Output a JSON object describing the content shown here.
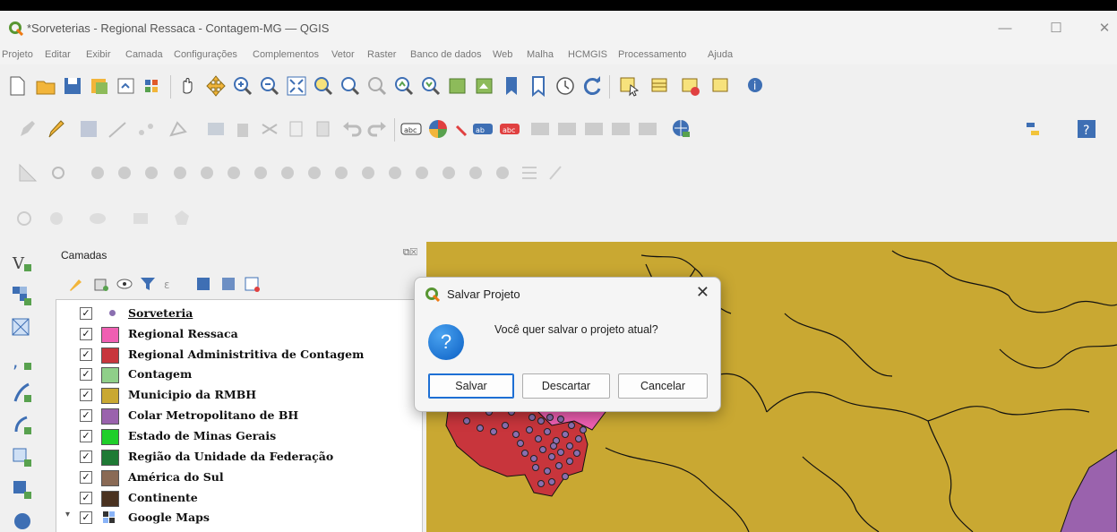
{
  "window": {
    "title": "*Sorveterias - Regional Ressaca - Contagem-MG — QGIS",
    "minimize": "—",
    "maximize": "☐",
    "close": "✕"
  },
  "menu": {
    "items": [
      "Projeto",
      "Editar",
      "Exibir",
      "Camada",
      "Configurações",
      "Complementos",
      "Vetor",
      "Raster",
      "Banco de dados",
      "Web",
      "Malha",
      "HCMGIS",
      "Processamento",
      "Ajuda"
    ]
  },
  "layers_panel": {
    "title": "Camadas",
    "controls": "⧉☒",
    "layers": [
      {
        "label": "Sorveteria",
        "color": "#8a6fb0",
        "underline": true,
        "symbol": "point",
        "expander": ""
      },
      {
        "label": "Regional Ressaca",
        "color": "#ef5fb2",
        "expander": ""
      },
      {
        "label": "Regional Administritiva de Contagem",
        "color": "#c8353c",
        "expander": ""
      },
      {
        "label": "Contagem",
        "color": "#8fcf89",
        "expander": ""
      },
      {
        "label": "Municipio da RMBH",
        "color": "#c9a832",
        "expander": ""
      },
      {
        "label": "Colar Metropolitano de BH",
        "color": "#9a62ad",
        "expander": ""
      },
      {
        "label": "Estado de Minas Gerais",
        "color": "#1fcf2a",
        "expander": ""
      },
      {
        "label": "Região da Unidade da Federação",
        "color": "#1f7a35",
        "expander": ""
      },
      {
        "label": "América do Sul",
        "color": "#8a6a55",
        "expander": ""
      },
      {
        "label": "Continente",
        "color": "#4a3220",
        "expander": ""
      },
      {
        "label": "Google Maps",
        "color": "#ffffff",
        "symbol": "raster",
        "expander": "▾"
      }
    ]
  },
  "dialog": {
    "title": "Salvar Projeto",
    "close": "✕",
    "icon": "?",
    "message": "Você quer salvar o projeto atual?",
    "buttons": {
      "save": "Salvar",
      "discard": "Descartar",
      "cancel": "Cancelar"
    }
  },
  "colors": {
    "map_background": "#c9a832",
    "region_red": "#c8353c",
    "region_pink": "#ef5fb2",
    "point_purple": "#8a6fb0",
    "collar_purple": "#9a62ad"
  }
}
